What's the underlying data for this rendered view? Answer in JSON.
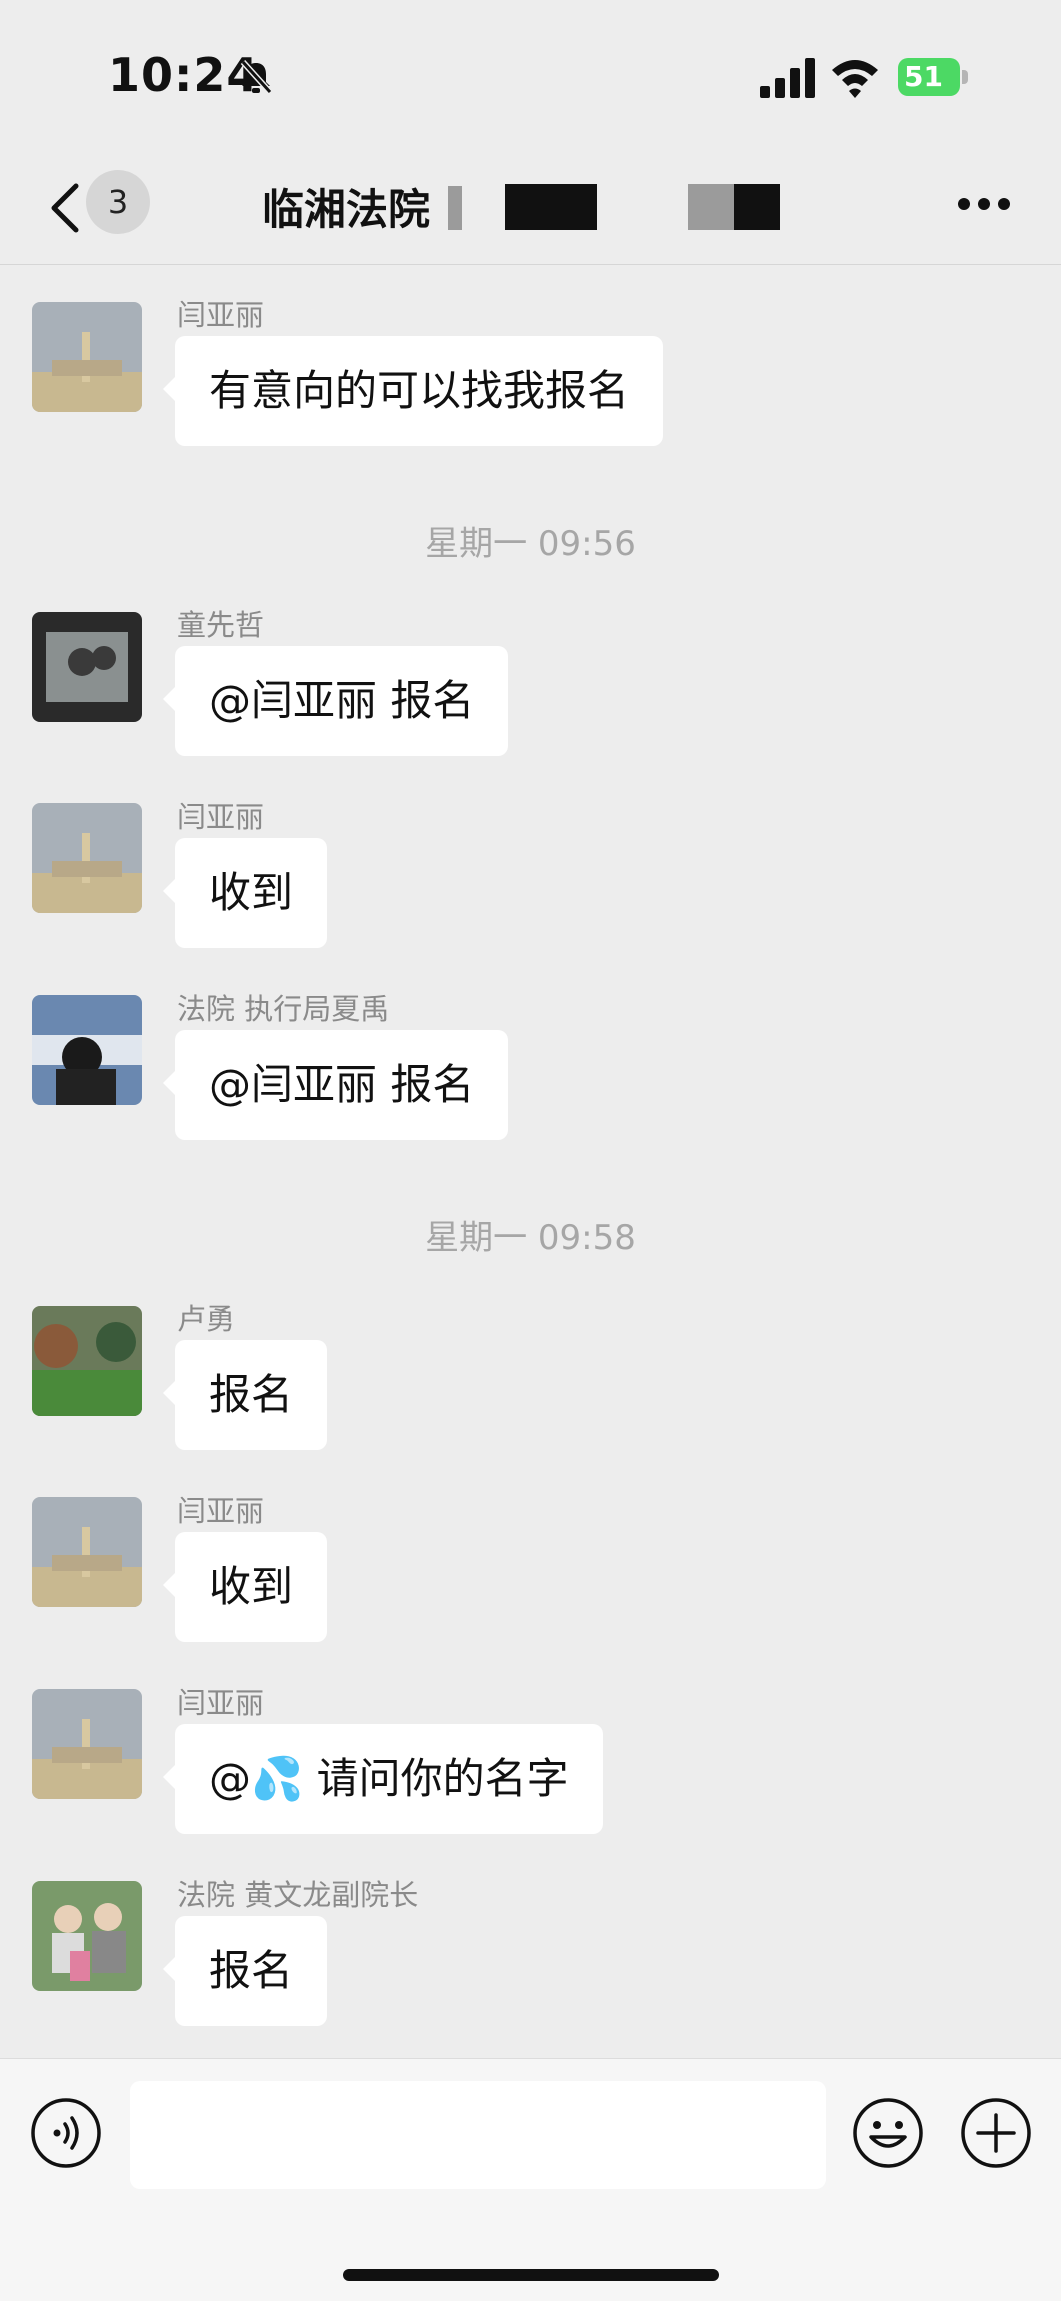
{
  "status_bar": {
    "time": "10:24",
    "battery": "51"
  },
  "nav": {
    "badge_count": "3",
    "title": "临湘法院"
  },
  "messages": [
    {
      "sender": "闫亚丽",
      "text": "有意向的可以找我报名"
    },
    {
      "timestamp": "星期一 09:56"
    },
    {
      "sender": "童先哲",
      "text": "@闫亚丽 报名"
    },
    {
      "sender": "闫亚丽",
      "text": "收到"
    },
    {
      "sender": "法院 执行局夏禹",
      "text": "@闫亚丽 报名"
    },
    {
      "timestamp": "星期一 09:58"
    },
    {
      "sender": "卢勇",
      "text": "报名"
    },
    {
      "sender": "闫亚丽",
      "text": "收到"
    },
    {
      "sender": "闫亚丽",
      "text": "@💦 请问你的名字"
    },
    {
      "sender": "法院 黄文龙副院长",
      "text": "报名"
    }
  ],
  "icons": {
    "back": "chevron-left-icon",
    "more": "more-dots-icon",
    "voice": "voice-icon",
    "emoji": "emoji-icon",
    "plus": "plus-icon",
    "mute": "bell-slash-icon"
  },
  "colors": {
    "background": "#ededed",
    "bubble": "#ffffff",
    "battery": "#4cd964"
  }
}
